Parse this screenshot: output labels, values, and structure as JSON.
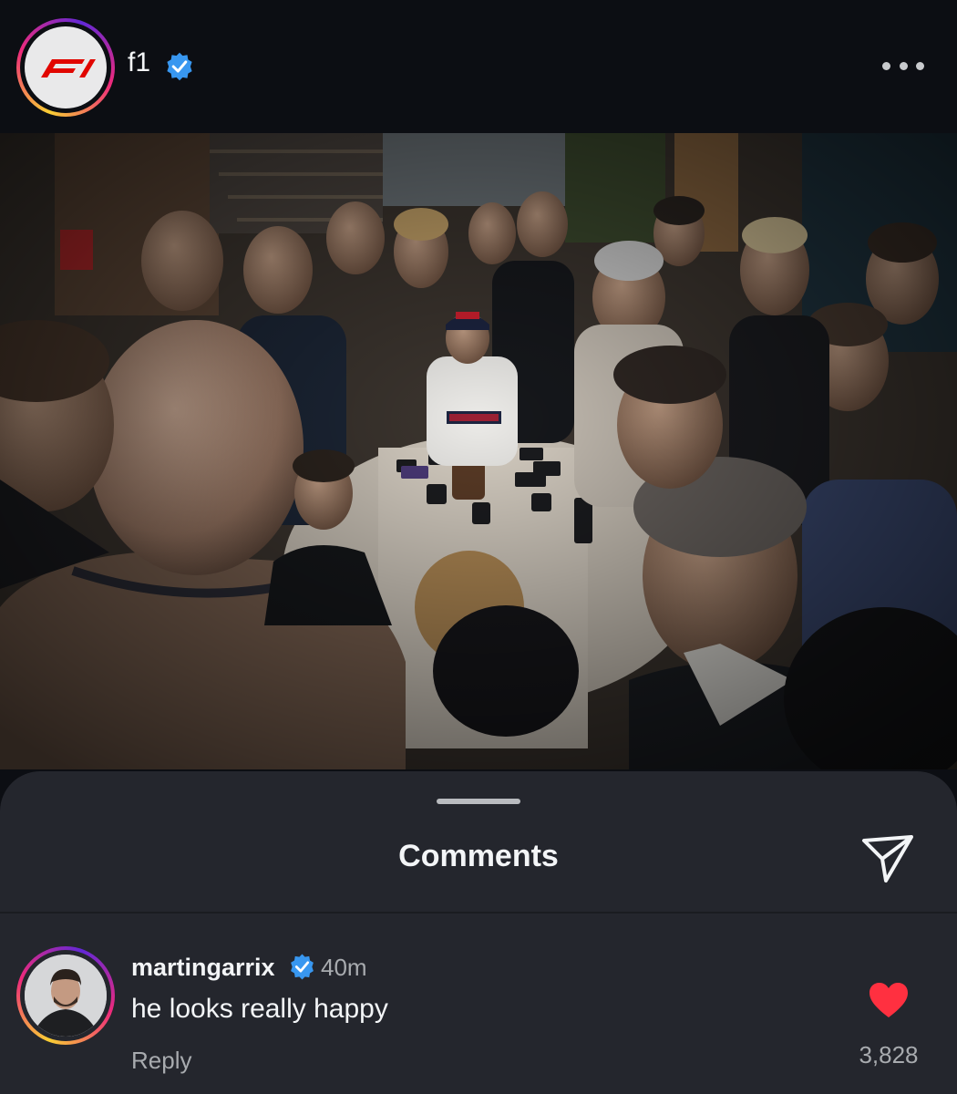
{
  "post": {
    "username": "f1",
    "account_icon": "f1-logo-icon",
    "verified_icon": "verified-badge-icon",
    "more_icon": "more-options-icon"
  },
  "comments_sheet": {
    "title": "Comments",
    "share_icon": "share-send-icon"
  },
  "comment": {
    "username": "martingarrix",
    "time": "40m",
    "text": "he looks really happy",
    "reply_label": "Reply",
    "like_count": "3,828",
    "liked": true
  },
  "colors": {
    "background": "#0c0e13",
    "sheet": "#24262d",
    "verified": "#3897f0",
    "heart": "#ff3040",
    "muted_text": "#a8abaf",
    "f1_red": "#e10600"
  }
}
